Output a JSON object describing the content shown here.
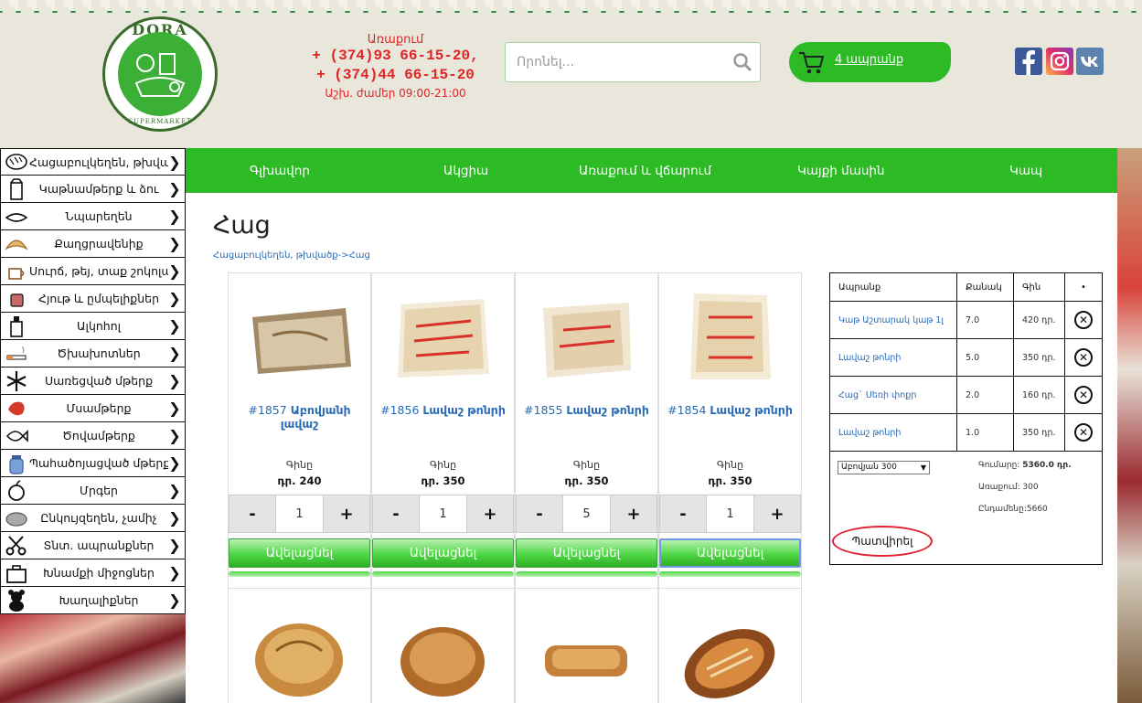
{
  "header": {
    "logo_name": "DORA",
    "logo_sub": "SUPERMARKET",
    "contact_label": "Առաքում",
    "phone1": "+ (374)93 66-15-20,",
    "phone2": "+ (374)44 66-15-20",
    "hours": "Աշխ. ժամեր 09:00-21:00",
    "search_placeholder": "Որոնել...",
    "cart_label": "4 ապրանք"
  },
  "colors": {
    "brand_green": "#2cba25",
    "phone_red": "#e02424",
    "link_blue": "#2a6bb5"
  },
  "sidebar": {
    "items": [
      {
        "label": "Հացաբուլկեղեն, թխվածք",
        "icon": "bread-icon"
      },
      {
        "label": "Կաթնամթերք և ձու",
        "icon": "milk-icon"
      },
      {
        "label": "Նպարեղեն",
        "icon": "grocery-icon"
      },
      {
        "label": "Քաղցրավենիք",
        "icon": "croissant-icon"
      },
      {
        "label": "Սուրճ, թեյ, տաք շոկոլադ",
        "icon": "coffee-icon"
      },
      {
        "label": "Հյութ և ըմպելիքներ",
        "icon": "juice-icon"
      },
      {
        "label": "Ալկոհոլ",
        "icon": "bottle-icon"
      },
      {
        "label": "Ծխախոտներ",
        "icon": "cigarette-icon"
      },
      {
        "label": "Սառեցված մթերք",
        "icon": "snowflake-icon"
      },
      {
        "label": "Մսամթերք",
        "icon": "meat-icon"
      },
      {
        "label": "Ծովամթերք",
        "icon": "fish-icon"
      },
      {
        "label": "Պահածոյացված մթերք",
        "icon": "jar-icon"
      },
      {
        "label": "Մրգեր",
        "icon": "apple-icon"
      },
      {
        "label": "Ընկույզեղեն, չամիչ",
        "icon": "nuts-icon"
      },
      {
        "label": "Տնտ. ապրանքներ",
        "icon": "scissors-icon"
      },
      {
        "label": "Խնամքի միջոցներ",
        "icon": "care-icon"
      },
      {
        "label": "Խաղալիքներ",
        "icon": "teddy-icon"
      }
    ]
  },
  "nav": {
    "tabs": [
      "Գլխավոր",
      "Ակցիա",
      "Առաքում և վճարում",
      "Կայքի մասին",
      "Կապ"
    ]
  },
  "page": {
    "title": "Հաց",
    "breadcrumb": "Հացաբուլկեղեն, թխվածք->Հաց"
  },
  "products": [
    {
      "id": "#1857",
      "name": "Աբովյանի լավաշ",
      "price_label": "Գինը",
      "price": "դր. 240",
      "qty": "1",
      "add_label": "Ավելացնել"
    },
    {
      "id": "#1856",
      "name": "Լավաշ թոնրի",
      "price_label": "Գինը",
      "price": "դր. 350",
      "qty": "1",
      "add_label": "Ավելացնել"
    },
    {
      "id": "#1855",
      "name": "Լավաշ թոնրի",
      "price_label": "Գինը",
      "price": "դր. 350",
      "qty": "5",
      "add_label": "Ավելացնել"
    },
    {
      "id": "#1854",
      "name": "Լավաշ թոնրի",
      "price_label": "Գինը",
      "price": "դր. 350",
      "qty": "1",
      "add_label": "Ավելացնել"
    }
  ],
  "qty_controls": {
    "minus": "-",
    "plus": "+"
  },
  "cart_table": {
    "headers": [
      "Ապրանք",
      "Քանակ",
      "Գին",
      "•"
    ],
    "rows": [
      {
        "product": "Կաթ Աշտարակ կաթ 1լ",
        "qty": "7.0",
        "price": "420 դր."
      },
      {
        "product": "Լավաշ թոնրի",
        "qty": "5.0",
        "price": "350 դր."
      },
      {
        "product": "Հաց` Սեռի փոքր",
        "qty": "2.0",
        "price": "160 դր."
      },
      {
        "product": "Լավաշ թոնրի",
        "qty": "1.0",
        "price": "350 դր."
      }
    ],
    "delivery_select": "Աբովյան 300",
    "sum_label": "Գումարը:",
    "sum_value": "5360.0 դր.",
    "delivery_line": "Առաքում: 300",
    "total_line": "Ընդամենը:5660",
    "order_label": "Պատվիրել"
  }
}
